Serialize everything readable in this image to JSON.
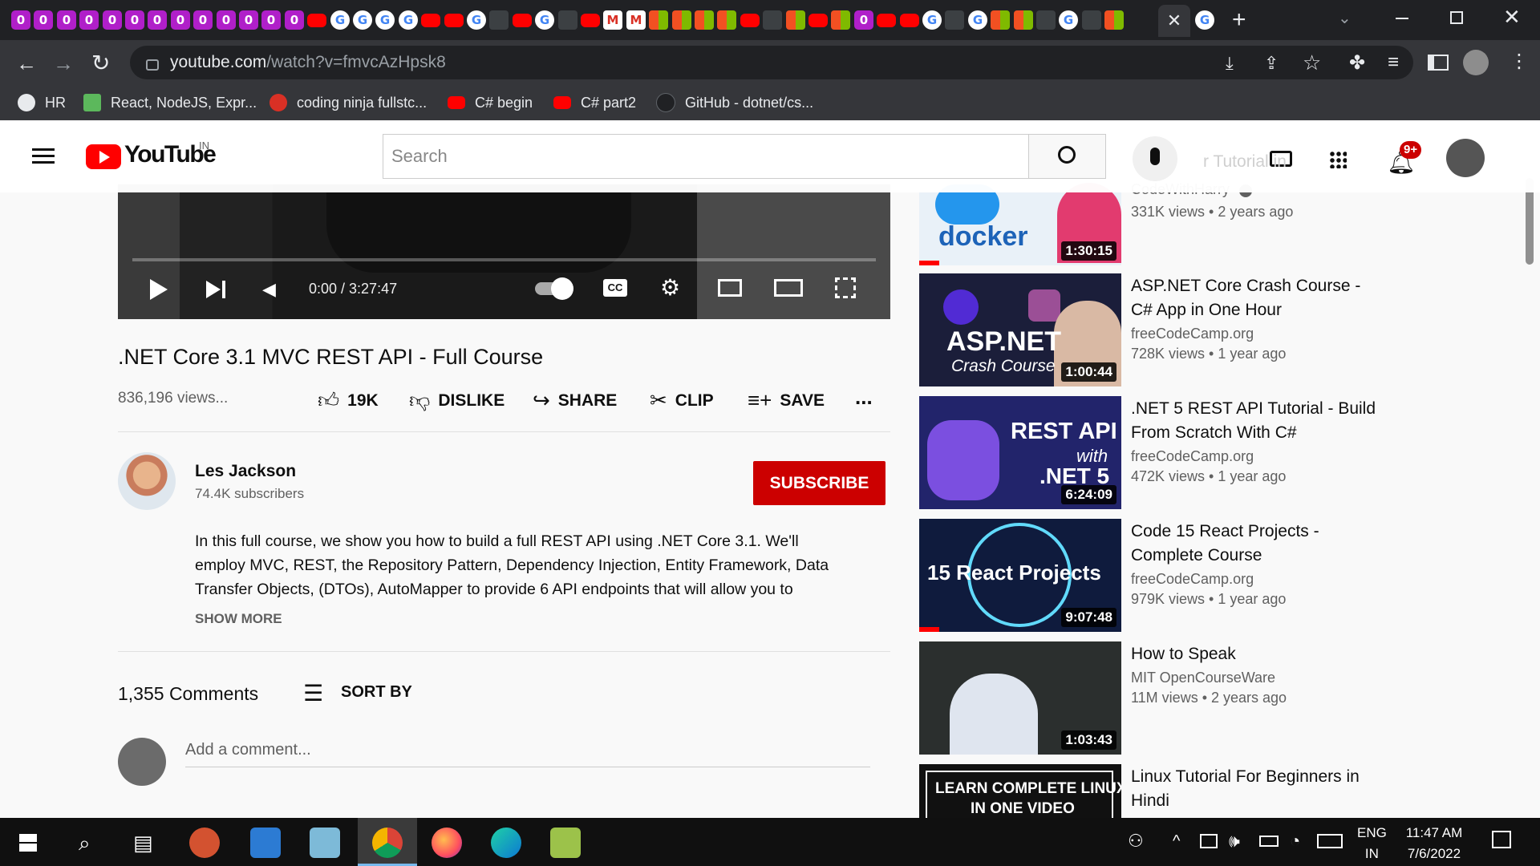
{
  "browser": {
    "url_host": "youtube.com",
    "url_path": "/watch?v=fmvcAzHpsk8",
    "bookmarks": [
      {
        "label": "HR"
      },
      {
        "label": "React, NodeJS, Expr..."
      },
      {
        "label": "coding ninja fullstc..."
      },
      {
        "label": "C# begin"
      },
      {
        "label": "C# part2"
      },
      {
        "label": "GitHub - dotnet/cs..."
      }
    ]
  },
  "youtube": {
    "logo_text": "YouTube",
    "region": "IN",
    "search_placeholder": "Search",
    "notifications_badge": "9+"
  },
  "player": {
    "time": "0:00 / 3:27:47",
    "cc": "CC"
  },
  "video": {
    "title": ".NET Core 3.1 MVC REST API - Full Course",
    "views": "836,196 views...",
    "likes": "19K",
    "dislike": "DISLIKE",
    "share": "SHARE",
    "clip": "CLIP",
    "save": "SAVE",
    "more": "..."
  },
  "channel": {
    "name": "Les Jackson",
    "subscribers": "74.4K subscribers",
    "subscribe": "SUBSCRIBE"
  },
  "description": {
    "line1": "In this full course, we show you how to build a full REST API using .NET Core 3.1. We'll",
    "line2": "employ MVC, REST, the Repository Pattern, Dependency Injection, Entity Framework, Data",
    "line3": "Transfer Objects, (DTOs), AutoMapper to provide 6 API endpoints that will allow you to",
    "show_more": "SHOW MORE"
  },
  "comments": {
    "count": "1,355 Comments",
    "sort_by": "SORT BY",
    "placeholder": "Add a comment..."
  },
  "sidebar": {
    "partial_title": "r Tutorial in",
    "items": [
      {
        "title": "",
        "channel": "CodeWithHarry",
        "meta": "331K views • 2 years ago",
        "duration": "1:30:15",
        "thumb_text": "docker"
      },
      {
        "title": "ASP.NET Core Crash Course - C# App in One Hour",
        "line1": "ASP.NET Core Crash Course -",
        "line2": "C# App in One Hour",
        "channel": "freeCodeCamp.org",
        "meta": "728K views • 1 year ago",
        "duration": "1:00:44",
        "thumb_text": "ASP.NET",
        "thumb_sub": "Crash Course"
      },
      {
        "line1": ".NET 5 REST API Tutorial - Build",
        "line2": "From Scratch With C#",
        "channel": "freeCodeCamp.org",
        "meta": "472K views • 1 year ago",
        "duration": "6:24:09",
        "thumb_text": "REST API",
        "thumb_sub": "with",
        "thumb_sub2": ".NET 5"
      },
      {
        "line1": "Code 15 React Projects -",
        "line2": "Complete Course",
        "channel": "freeCodeCamp.org",
        "meta": "979K views • 1 year ago",
        "duration": "9:07:48",
        "thumb_text": "15 React Projects"
      },
      {
        "line1": "How to Speak",
        "line2": "",
        "channel": "MIT OpenCourseWare",
        "meta": "11M views • 2 years ago",
        "duration": "1:03:43"
      },
      {
        "line1": "Linux Tutorial For Beginners in",
        "line2": "Hindi",
        "thumb_text": "LEARN COMPLETE LINUX",
        "thumb_sub": "IN ONE VIDEO"
      }
    ]
  },
  "taskbar": {
    "lang1": "ENG",
    "lang2": "IN",
    "time": "11:47 AM",
    "date": "7/6/2022"
  },
  "colors": {
    "subscribe": "#cc0000",
    "yt_red": "#ff0000",
    "chrome_dark": "#202124",
    "chrome_toolbar": "#35363a"
  }
}
